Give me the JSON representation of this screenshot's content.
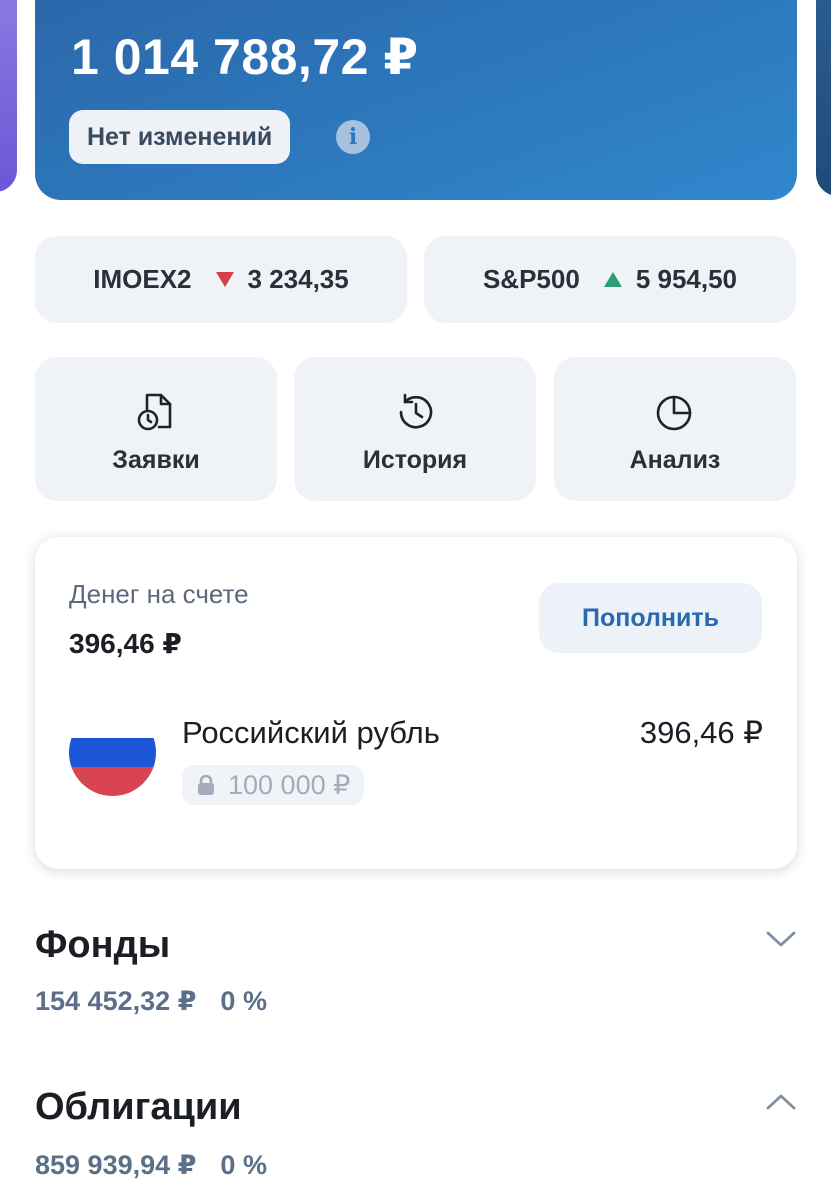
{
  "portfolio": {
    "total": "1 014 788,72 ₽",
    "change_label": "Нет изменений",
    "colors": {
      "card_start": "#2b66a8",
      "card_end": "#3187cc"
    }
  },
  "indices": [
    {
      "name": "IMOEX2",
      "direction": "down",
      "value": "3 234,35",
      "color": "#d83d4a"
    },
    {
      "name": "S&P500",
      "direction": "up",
      "value": "5 954,50",
      "color": "#2d9d76"
    }
  ],
  "actions": [
    {
      "label": "Заявки",
      "icon": "orders-icon"
    },
    {
      "label": "История",
      "icon": "history-icon"
    },
    {
      "label": "Анализ",
      "icon": "pie-chart-icon"
    }
  ],
  "cash": {
    "title": "Денег на счете",
    "amount": "396,46 ₽",
    "topup_label": "Пополнить",
    "currency": {
      "name": "Российский рубль",
      "amount": "396,46 ₽",
      "blocked": "100 000 ₽",
      "flag_icon": "russia-flag-icon"
    }
  },
  "sections": [
    {
      "title": "Фонды",
      "value": "154 452,32 ₽",
      "percent": "0 %",
      "expanded": false
    },
    {
      "title": "Облигации",
      "value": "859 939,94 ₽",
      "percent": "0 %",
      "expanded": true
    }
  ]
}
